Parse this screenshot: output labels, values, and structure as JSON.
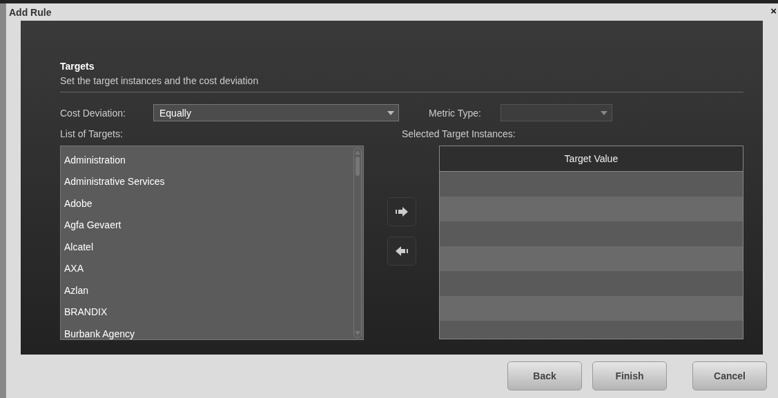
{
  "window": {
    "title": "Add Rule",
    "close": "×"
  },
  "section": {
    "title": "Targets",
    "subtitle": "Set the target instances and the cost deviation"
  },
  "cost_deviation": {
    "label": "Cost Deviation:",
    "value": "Equally",
    "disabled": false
  },
  "metric_type": {
    "label": "Metric Type:",
    "disabled": true
  },
  "list_of_targets": {
    "label": "List of Targets:",
    "items": [
      {
        "label": "Administration",
        "selected": false
      },
      {
        "label": "Administrative Services",
        "selected": false
      },
      {
        "label": "Adobe",
        "selected": false
      },
      {
        "label": "Agfa Gevaert",
        "selected": false
      },
      {
        "label": "Alcatel",
        "selected": false
      },
      {
        "label": "AXA",
        "selected": false
      },
      {
        "label": "Azlan",
        "selected": false
      },
      {
        "label": "BRANDIX",
        "selected": false
      },
      {
        "label": "Burbank Agency",
        "selected": false
      }
    ]
  },
  "selected_targets": {
    "label": "Selected Target Instances:",
    "columns": [
      "Target Value"
    ]
  },
  "buttons": [
    "Back",
    "Finish",
    "Cancel"
  ]
}
